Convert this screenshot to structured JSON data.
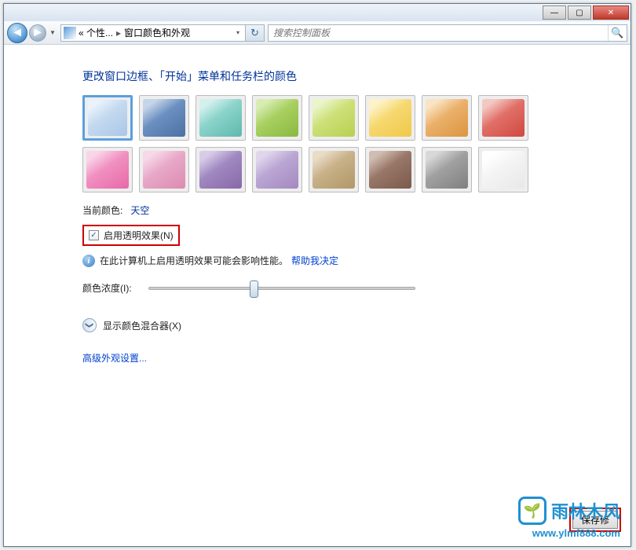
{
  "titlebar": {
    "min": "—",
    "max": "▢",
    "close": "✕"
  },
  "nav": {
    "back": "◄",
    "fwd": "►",
    "drop": "▼",
    "breadcrumb1": "« 个性...",
    "sep": "▸",
    "breadcrumb2": "窗口颜色和外观",
    "refresh": "↻"
  },
  "search": {
    "placeholder": "搜索控制面板",
    "icon": "🔍"
  },
  "page": {
    "title": "更改窗口边框、「开始」菜单和任务栏的颜色"
  },
  "current": {
    "label": "当前颜色:",
    "name": "天空"
  },
  "transparency": {
    "check": "✓",
    "label": "启用透明效果(N)"
  },
  "info": {
    "text": "在此计算机上启用透明效果可能会影响性能。",
    "link": "帮助我决定"
  },
  "intensity": {
    "label": "颜色浓度(I):"
  },
  "mixer": {
    "arrow": "❯",
    "label": "显示颜色混合器(X)"
  },
  "advanced": {
    "label": "高级外观设置..."
  },
  "save": {
    "label": "保存修"
  },
  "watermark": {
    "emoji": "🌱",
    "text": "雨林木风",
    "url": "www.ylmf888.com"
  }
}
